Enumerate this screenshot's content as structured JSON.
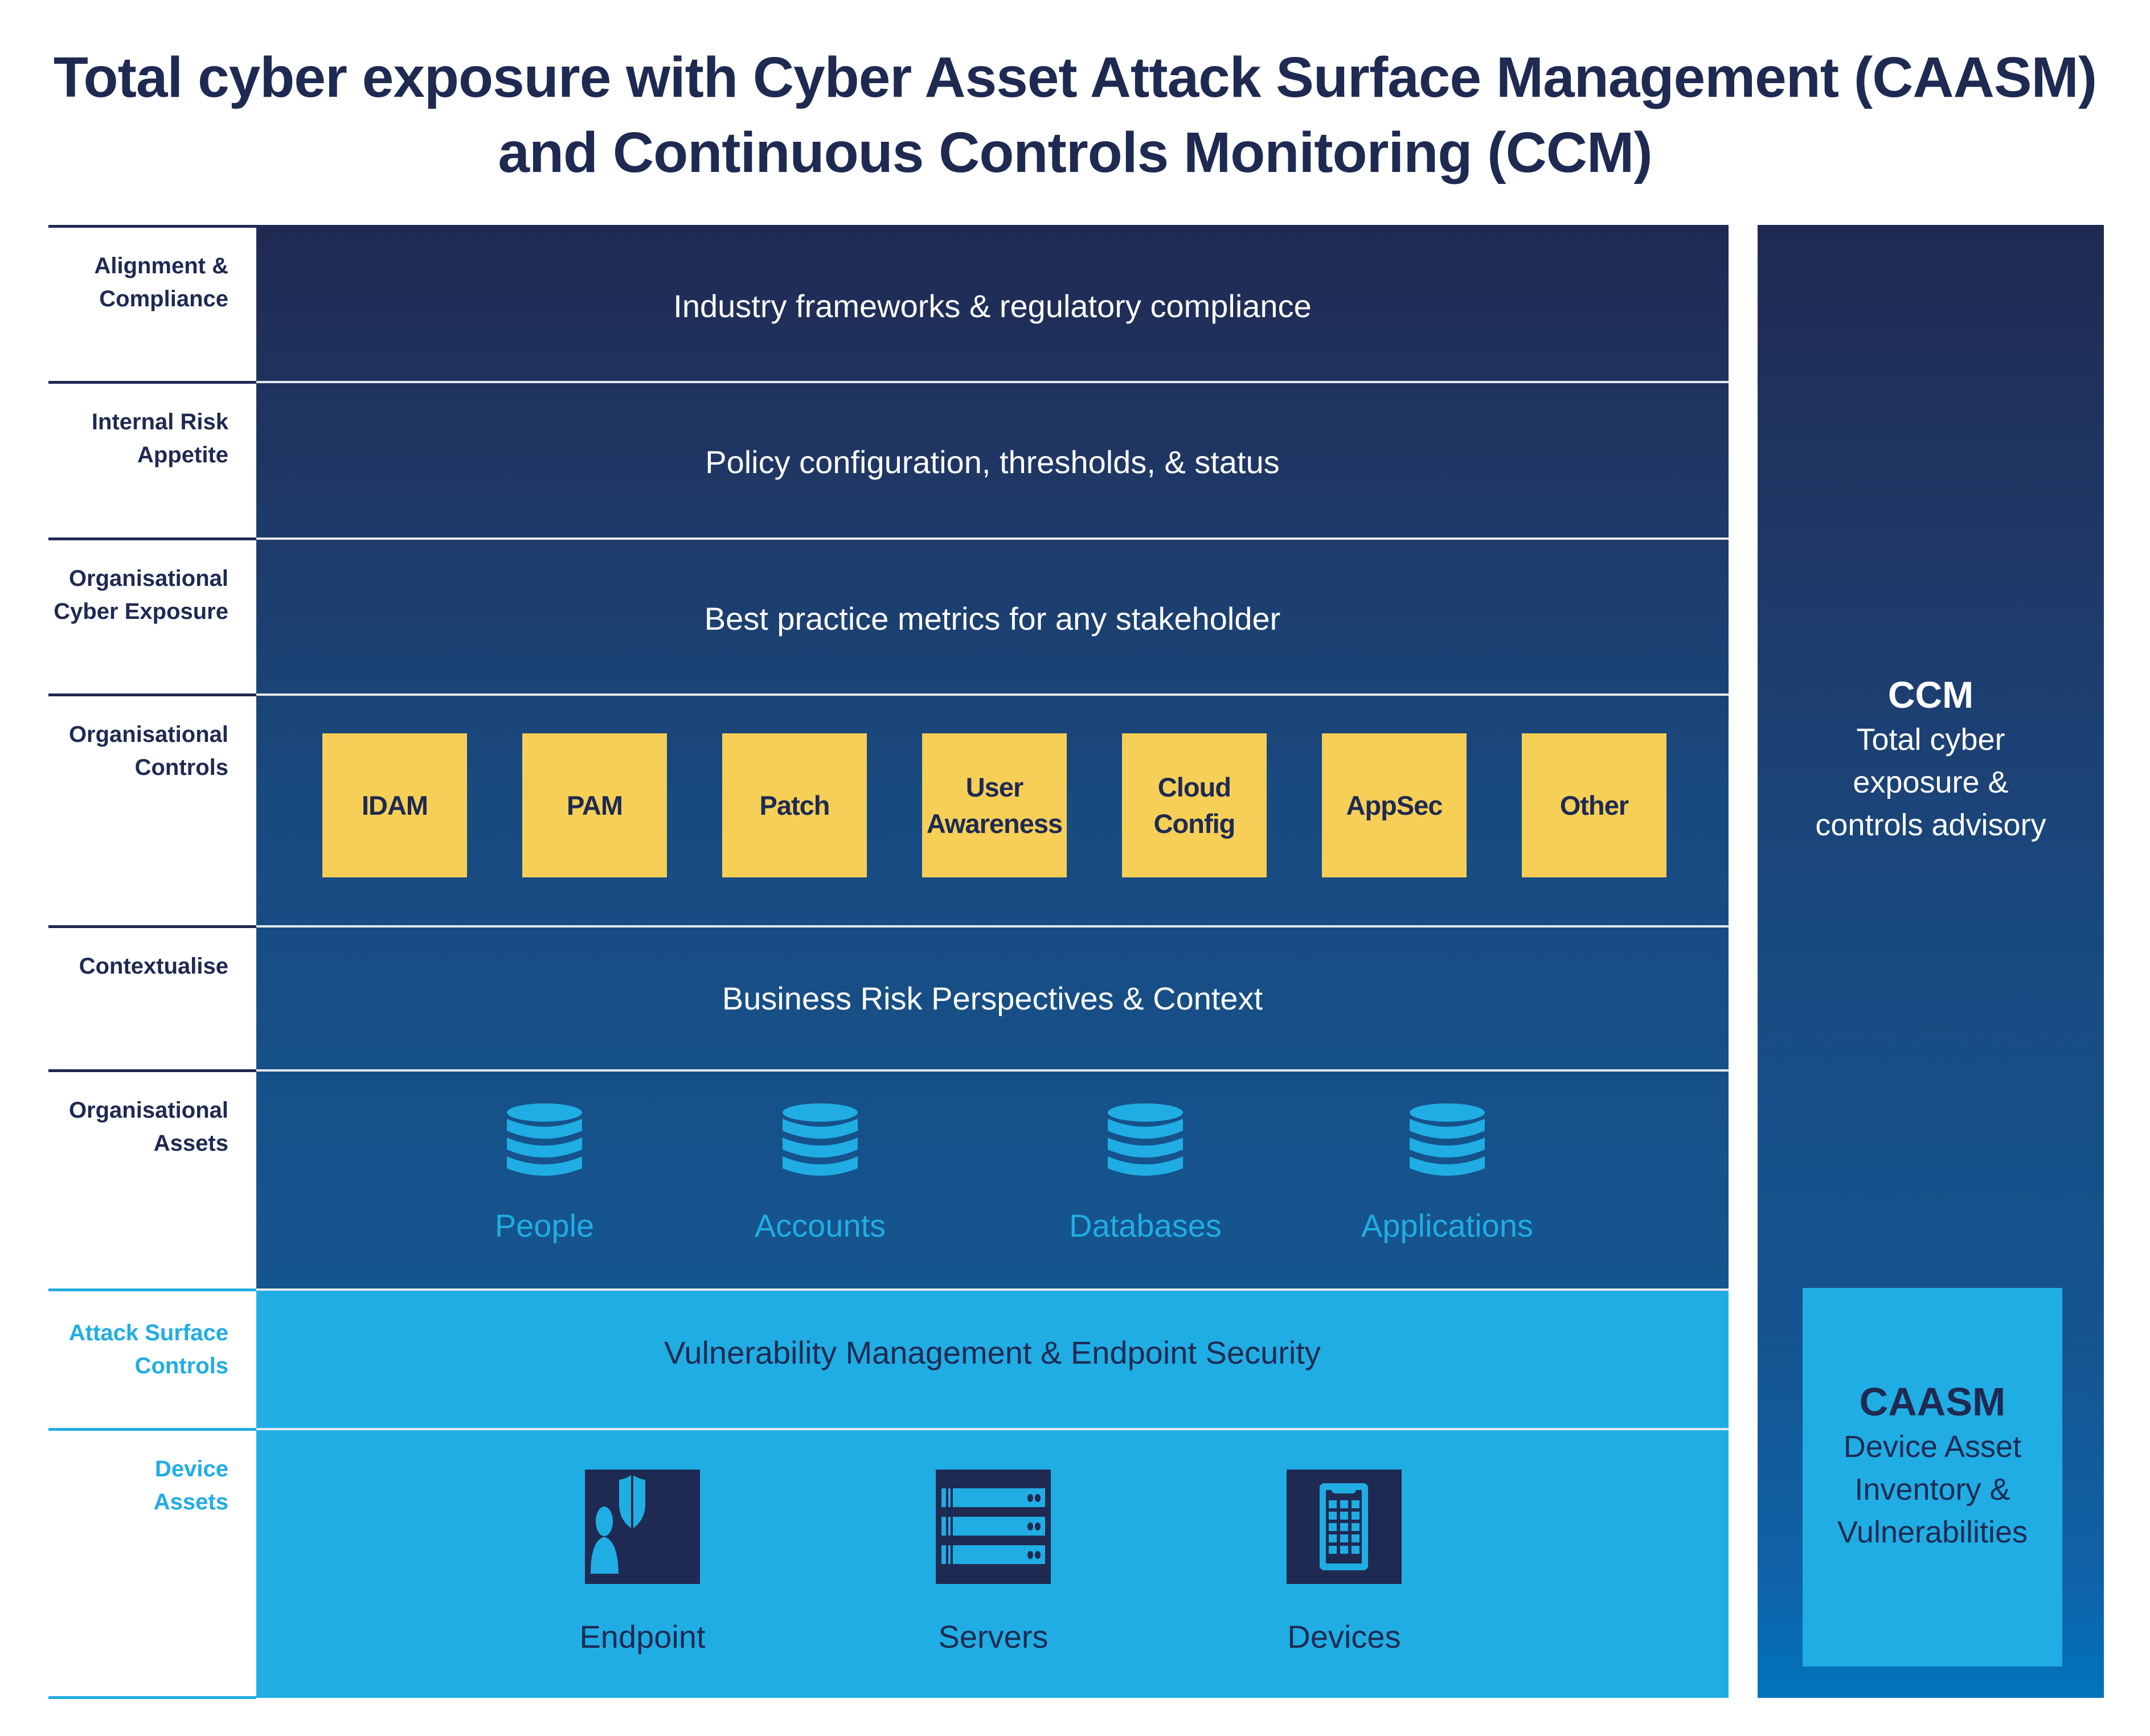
{
  "title": {
    "line1": "Total cyber exposure with Cyber Asset Attack Surface Management (CAASM)",
    "line2": "and Continuous Controls Monitoring (CCM)"
  },
  "colors": {
    "navy": "#1e2a52",
    "mid_blue": "#15558f",
    "light_blue": "#20ade3",
    "yellow": "#f6cf57",
    "deep_blue": "#0074bd"
  },
  "layers": [
    {
      "label_line1": "Alignment &",
      "label_line2": "Compliance",
      "content": "Industry frameworks & regulatory compliance"
    },
    {
      "label_line1": "Internal Risk",
      "label_line2": "Appetite",
      "content": "Policy configuration, thresholds, & status"
    },
    {
      "label_line1": "Organisational",
      "label_line2": "Cyber Exposure",
      "content": "Best practice metrics for any stakeholder"
    },
    {
      "label_line1": "Organisational",
      "label_line2": "Controls",
      "content": ""
    },
    {
      "label_line1": "Contextualise",
      "label_line2": "",
      "content": "Business Risk Perspectives & Context"
    },
    {
      "label_line1": "Organisational",
      "label_line2": "Assets",
      "content": ""
    },
    {
      "label_line1": "Attack Surface",
      "label_line2": "Controls",
      "content": "Vulnerability Management & Endpoint Security"
    },
    {
      "label_line1": "Device",
      "label_line2": "Assets",
      "content": ""
    }
  ],
  "controls": [
    {
      "line1": "IDAM",
      "line2": ""
    },
    {
      "line1": "PAM",
      "line2": ""
    },
    {
      "line1": "Patch",
      "line2": ""
    },
    {
      "line1": "User",
      "line2": "Awareness"
    },
    {
      "line1": "Cloud",
      "line2": "Config"
    },
    {
      "line1": "AppSec",
      "line2": ""
    },
    {
      "line1": "Other",
      "line2": ""
    }
  ],
  "org_assets": [
    {
      "label": "People",
      "icon": "database-icon"
    },
    {
      "label": "Accounts",
      "icon": "database-icon"
    },
    {
      "label": "Databases",
      "icon": "database-icon"
    },
    {
      "label": "Applications",
      "icon": "database-icon"
    }
  ],
  "device_assets": [
    {
      "label": "Endpoint",
      "icon": "endpoint-user-shield-icon"
    },
    {
      "label": "Servers",
      "icon": "server-rack-icon"
    },
    {
      "label": "Devices",
      "icon": "mobile-device-icon"
    }
  ],
  "ccm": {
    "title": "CCM",
    "line1": "Total cyber",
    "line2": "exposure &",
    "line3": "controls advisory"
  },
  "caasm": {
    "title": "CAASM",
    "line1": "Device Asset",
    "line2": "Inventory &",
    "line3": "Vulnerabilities"
  }
}
